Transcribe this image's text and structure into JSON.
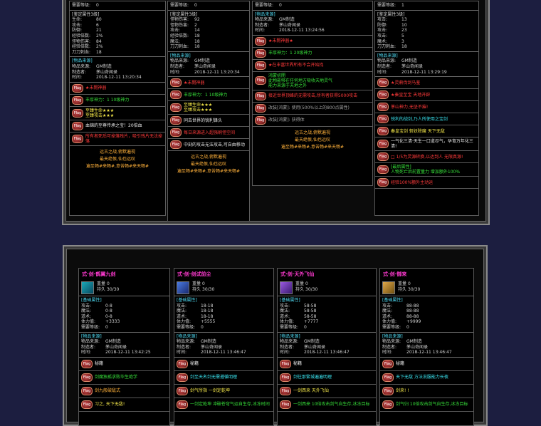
{
  "top_cards": [
    {
      "header": [
        {
          "k": "需要等级:",
          "v": "0"
        }
      ],
      "attr_title": "[鉴定属性3级]",
      "attrs": [
        {
          "k": "生命:",
          "v": "80"
        },
        {
          "k": "攻击:",
          "v": "6"
        },
        {
          "k": "防御:",
          "v": "21"
        },
        {
          "k": "经验倍数:",
          "v": "2%"
        },
        {
          "k": "怪物伤害:",
          "v": "84"
        },
        {
          "k": "经验倍数:",
          "v": "2%"
        },
        {
          "k": "刀刀刺血:",
          "v": "18"
        }
      ],
      "origin_title": "[物品来源]",
      "origin": [
        {
          "k": "物品来源:",
          "v": "GM制造"
        },
        {
          "k": "制造者:",
          "v": "茅山奇闻录"
        },
        {
          "k": "时间:",
          "v": "2018-12-11 13:20:34"
        }
      ],
      "rows": [
        {
          "cls": "red",
          "text": "★未開神器"
        },
        {
          "cls": "grn",
          "text": "丰厚神力：1 10级神力"
        },
        {
          "cls": "yel",
          "text": "至臻生命★★★\n至臻攻击★★★"
        },
        {
          "cls": "wht",
          "text": "血锦的至尊传承之宝！20倍血"
        },
        {
          "cls": "red",
          "text": "所有者死后可掉落残片，吸引残片无法掉落"
        }
      ],
      "footer": [
        "远古之战,俯默遍视",
        "最天绝恨,仙也远叹",
        "遍至畅#来畅#,意苦畅#来天畅#"
      ]
    },
    {
      "header": [
        {
          "k": "需要等级:",
          "v": "0"
        }
      ],
      "attr_title": "[鉴定属性3级]",
      "attrs": [
        {
          "k": "怪物伤害:",
          "v": "92"
        },
        {
          "k": "怪物伤害:",
          "v": "2"
        },
        {
          "k": "攻击:",
          "v": "14"
        },
        {
          "k": "经验倍数:",
          "v": "18"
        },
        {
          "k": "魔法:",
          "v": "18"
        },
        {
          "k": "刀刀刺血:",
          "v": "18"
        }
      ],
      "origin_title": "[物品来源]",
      "origin": [
        {
          "k": "物品来源:",
          "v": "GM制造"
        },
        {
          "k": "制造者:",
          "v": "茅山奇闻录"
        },
        {
          "k": "时间:",
          "v": "2018-12-11 13:20:34"
        }
      ],
      "rows": [
        {
          "cls": "red",
          "text": "★未開神器"
        },
        {
          "cls": "grn",
          "text": "丰厚神力：1 10级神力"
        },
        {
          "cls": "yel",
          "text": "至臻生命★★★\n至臻攻击★★★"
        },
        {
          "cls": "wht",
          "text": "同去世界的锐利锋头"
        },
        {
          "cls": "red",
          "text": "每日来源进入超强刷怪空间"
        },
        {
          "cls": "wht",
          "text": "中刻的攻击无法攻击,可自由移动"
        }
      ],
      "footer": [
        "远古之战,俯默遍视",
        "最天绝恨,仙也远叹",
        "遍至畅#来畅#,意苦畅#来天畅#"
      ]
    },
    {
      "header": [
        {
          "k": "需要等级:",
          "v": "0"
        }
      ],
      "origin_title": "[物品来源]",
      "origin": [
        {
          "k": "物品来源:",
          "v": "GM制造"
        },
        {
          "k": "制造者:",
          "v": "茅山奇闻录"
        },
        {
          "k": "时间:",
          "v": "2018-12-11 13:24:56"
        }
      ],
      "rows": [
        {
          "cls": "red",
          "text": "★未開神器★"
        },
        {
          "cls": "grn",
          "text": "丰厚神力：1 20级神力"
        },
        {
          "cls": "red",
          "text": "★在丰富世界所有不会开始找"
        },
        {
          "cls": "grn",
          "text": "鸿蒙初開\n此物能够在任何地方吸收天地灵气\n能力来源于天地之外"
        },
        {
          "cls": "red",
          "text": "接近世界顶峰的无需攻击,所有者获得5000攻击"
        },
        {
          "cls": "gry",
          "text": "改装[鸿蒙]: 使用(500%以上的800点属性)"
        },
        {
          "cls": "gry",
          "text": "改装[鸿蒙]: 获得体"
        }
      ],
      "footer": [
        "远古之战,俯默遍视",
        "最天绝恨,仙也远叹",
        "遍至畅#来畅#,意苦畅#来天畅#"
      ]
    },
    {
      "header": [
        {
          "k": "需要等级:",
          "v": "1"
        }
      ],
      "attr_title": "[鉴定属性3级]",
      "attrs": [
        {
          "k": "攻击:",
          "v": "13"
        },
        {
          "k": "防御:",
          "v": "10"
        },
        {
          "k": "攻击:",
          "v": "23"
        },
        {
          "k": "攻击:",
          "v": "5"
        },
        {
          "k": "魔术:",
          "v": "3"
        },
        {
          "k": "刀刀刺血:",
          "v": "18"
        }
      ],
      "origin_title": "[物品来源]",
      "origin": [
        {
          "k": "物品来源:",
          "v": "GM制造"
        },
        {
          "k": "制造者:",
          "v": "茅山奇闻录"
        },
        {
          "k": "时间:",
          "v": "2018-12-11 13:29:19"
        }
      ],
      "rows": [
        {
          "cls": "red",
          "text": "★灵鼎伐剑马鉴"
        },
        {
          "cls": "red",
          "text": "★秦皇至宝 天地开辟"
        },
        {
          "cls": "red",
          "text": "茅山神力,无坚不摧!"
        },
        {
          "cls": "cyn",
          "text": "锐利的战剑,乃人所使用之宝剑"
        },
        {
          "cls": "yel",
          "text": "秦皇宝剑 斩妖除魔 天下无敌"
        },
        {
          "cls": "wht",
          "text": "一气化三清·天生一口道尽气，孕育万年化三清!"
        },
        {
          "cls": "red",
          "text": "□ 1/5为灵源转换,以达到人 无限真源!"
        },
        {
          "cls": "grn",
          "text": "[最后属性]\n人物死亡后前置量力 增加额外100%"
        },
        {
          "cls": "red",
          "text": "经验100%额外主动运"
        }
      ],
      "footer": []
    }
  ],
  "bottom_cards": [
    {
      "name": "式·剑·鹤翼九剑",
      "book": "book1",
      "stats": [
        {
          "k": "重量",
          "v": "0"
        },
        {
          "k": "持久",
          "v": "30/30"
        }
      ],
      "base_title": "[基础属性]",
      "base": [
        {
          "k": "攻击:",
          "v": "0-8"
        },
        {
          "k": "魔法:",
          "v": "0-8"
        },
        {
          "k": "道术:",
          "v": "0-8"
        },
        {
          "k": "体力值:",
          "v": "+3333"
        },
        {
          "k": "需要等级:",
          "v": "0"
        }
      ],
      "origin_title": "[物品来源]",
      "origin": [
        {
          "k": "物品来源:",
          "v": "GM制造"
        },
        {
          "k": "制造者:",
          "v": "茅山奇闻录"
        },
        {
          "k": "时间:",
          "v": "2018-12-11 13:42:25"
        }
      ],
      "rows": [
        {
          "cls": "wht",
          "text": "秘籍"
        },
        {
          "cls": "grn",
          "text": "剑魔独孤求败毕生绝学"
        },
        {
          "cls": "org",
          "text": "剑九般破敌式"
        },
        {
          "cls": "yel",
          "text": "习之, 天下无敌!"
        }
      ]
    },
    {
      "name": "式·剑·剑试前尘",
      "book": "book2",
      "stats": [
        {
          "k": "重量",
          "v": "0"
        },
        {
          "k": "持久",
          "v": "30/30"
        }
      ],
      "base_title": "[基础属性]",
      "base": [
        {
          "k": "攻击:",
          "v": "18-18"
        },
        {
          "k": "魔法:",
          "v": "18-18"
        },
        {
          "k": "道术:",
          "v": "18-18"
        },
        {
          "k": "体力值:",
          "v": "+5555"
        },
        {
          "k": "需要等级:",
          "v": "0"
        }
      ],
      "origin_title": "[物品来源]",
      "origin": [
        {
          "k": "物品来源:",
          "v": "GM制造"
        },
        {
          "k": "制造者:",
          "v": "茅山奇闻录"
        },
        {
          "k": "时间:",
          "v": "2018-12-11 13:46:47"
        }
      ],
      "rows": [
        {
          "cls": "wht",
          "text": "秘籍"
        },
        {
          "cls": "cyn",
          "text": "剑至天名剑无需遵循明理"
        },
        {
          "cls": "yel",
          "text": "剑气所指 一剑定乾坤"
        },
        {
          "cls": "grn",
          "text": "一剑定乾坤 冲破苍穹气运自生存,冰冻时间"
        }
      ]
    },
    {
      "name": "式·剑·天外飞仙",
      "book": "book3",
      "stats": [
        {
          "k": "重量",
          "v": "0"
        },
        {
          "k": "持久",
          "v": "30/30"
        }
      ],
      "base_title": "[基础属性]",
      "base": [
        {
          "k": "攻击:",
          "v": "58-58"
        },
        {
          "k": "魔法:",
          "v": "58-58"
        },
        {
          "k": "道术:",
          "v": "58-58"
        },
        {
          "k": "体力值:",
          "v": "+7777"
        },
        {
          "k": "需要等级:",
          "v": "0"
        }
      ],
      "origin_title": "[物品来源]",
      "origin": [
        {
          "k": "物品来源:",
          "v": "GM制造"
        },
        {
          "k": "制造者:",
          "v": "茅山奇闻录"
        },
        {
          "k": "时间:",
          "v": "2018-12-11 13:46:47"
        }
      ],
      "rows": [
        {
          "cls": "wht",
          "text": "秘籍"
        },
        {
          "cls": "cyn",
          "text": "剑往那繁城遍遍明理"
        },
        {
          "cls": "yel",
          "text": "一剑西来 天外飞仙"
        },
        {
          "cls": "grn",
          "text": "一剑西来 10倍攻击剑气自生存,冰冻目标"
        }
      ]
    },
    {
      "name": "式·剑·御来",
      "book": "book4",
      "stats": [
        {
          "k": "重量",
          "v": "0"
        },
        {
          "k": "持久",
          "v": "30/30"
        }
      ],
      "base_title": "[基础属性]",
      "base": [
        {
          "k": "攻击:",
          "v": "88-88"
        },
        {
          "k": "魔法:",
          "v": "88-88"
        },
        {
          "k": "道术:",
          "v": "88-88"
        },
        {
          "k": "体力值:",
          "v": "+9999"
        },
        {
          "k": "需要等级:",
          "v": "0"
        }
      ],
      "origin_title": "[物品来源]",
      "origin": [
        {
          "k": "物品来源:",
          "v": "GM制造"
        },
        {
          "k": "制造者:",
          "v": "茅山奇闻录"
        },
        {
          "k": "时间:",
          "v": "2018-12-11 13:46:47"
        }
      ],
      "rows": [
        {
          "cls": "wht",
          "text": "秘籍"
        },
        {
          "cls": "cyn",
          "text": "天下无敌 方法说服能力长夜"
        },
        {
          "cls": "yel",
          "text": "剑来! !"
        },
        {
          "cls": "grn",
          "text": "剑气归 10倍攻击剑气自生存,冰冻目标"
        }
      ]
    }
  ],
  "icon_label": "flag-icon"
}
